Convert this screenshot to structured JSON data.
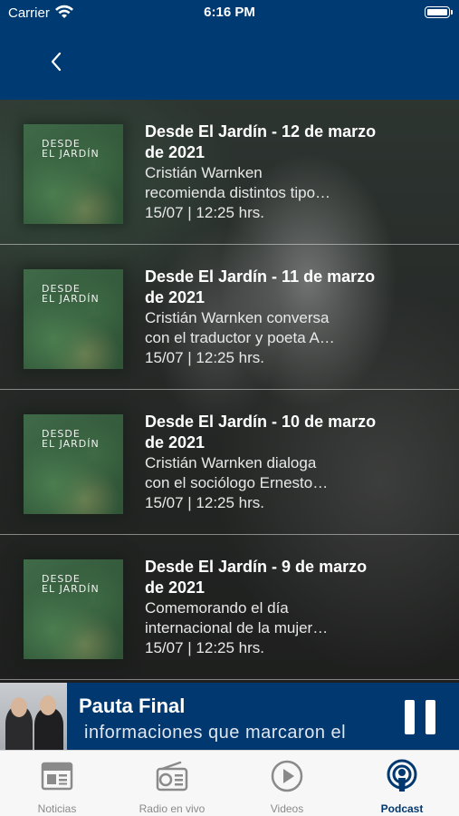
{
  "status_bar": {
    "carrier": "Carrier",
    "time": "6:16 PM"
  },
  "episodes": [
    {
      "thumb_text": "DESDE\nEL JARDÍN",
      "title": "Desde El Jardín - 12 de marzo de 2021",
      "description": "Cristián Warnken recomienda distintos tipo…",
      "date": "15/07 | 12:25 hrs."
    },
    {
      "thumb_text": "DESDE\nEL JARDÍN",
      "title": "Desde El Jardín - 11 de marzo de 2021",
      "description": "Cristián Warnken conversa con el traductor y poeta A…",
      "date": "15/07 | 12:25 hrs."
    },
    {
      "thumb_text": "DESDE\nEL JARDÍN",
      "title": "Desde El Jardín - 10 de marzo de 2021",
      "description": "Cristián Warnken dialoga con el sociólogo Ernesto…",
      "date": "15/07 | 12:25 hrs."
    },
    {
      "thumb_text": "DESDE\nEL JARDÍN",
      "title": "Desde El Jardín - 9 de marzo de 2021",
      "description": "Comemorando el día internacional de la mujer…",
      "date": "15/07 | 12:25 hrs."
    }
  ],
  "player": {
    "title": "Pauta Final",
    "subtitle": "informaciones que marcaron el"
  },
  "tabs": [
    {
      "label": "Noticias",
      "icon": "newspaper-icon"
    },
    {
      "label": "Radio en vivo",
      "icon": "radio-icon"
    },
    {
      "label": "Videos",
      "icon": "play-circle-icon"
    },
    {
      "label": "Podcast",
      "icon": "podcast-icon"
    }
  ],
  "colors": {
    "header": "#003a72",
    "player": "#00386f",
    "tab_active": "#00386f",
    "tab_inactive": "#8a8a8a"
  }
}
